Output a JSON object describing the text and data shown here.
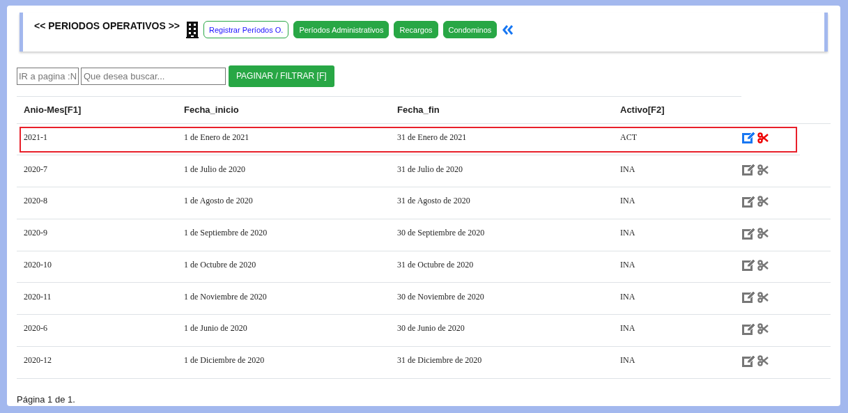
{
  "header": {
    "title": "<< PERIODOS OPERATIVOS >>",
    "buttons": [
      {
        "label": "Registrar Períodos O.",
        "kind": "outline"
      },
      {
        "label": "Períodos Administrativos",
        "kind": "solid"
      },
      {
        "label": "Recargos",
        "kind": "solid"
      },
      {
        "label": "Condominos",
        "kind": "solid"
      }
    ]
  },
  "filter": {
    "page_placeholder": "IR a pagina :N",
    "search_placeholder": "Que desea buscar...",
    "button": "PAGINAR / FILTRAR [F]"
  },
  "table": {
    "columns": [
      "Anio-Mes[F1]",
      "Fecha_inicio",
      "Fecha_fin",
      "Activo[F2]"
    ],
    "rows": [
      {
        "cells": [
          "2021-1",
          "1 de Enero de 2021",
          "31 de Enero de 2021",
          "ACT"
        ],
        "selected": true
      },
      {
        "cells": [
          "2020-7",
          "1 de Julio de 2020",
          "31 de Julio de 2020",
          "INA"
        ],
        "selected": false
      },
      {
        "cells": [
          "2020-8",
          "1 de Agosto de 2020",
          "31 de Agosto de 2020",
          "INA"
        ],
        "selected": false
      },
      {
        "cells": [
          "2020-9",
          "1 de Septiembre de 2020",
          "30 de Septiembre de 2020",
          "INA"
        ],
        "selected": false
      },
      {
        "cells": [
          "2020-10",
          "1 de Octubre de 2020",
          "31 de Octubre de 2020",
          "INA"
        ],
        "selected": false
      },
      {
        "cells": [
          "2020-11",
          "1 de Noviembre de 2020",
          "30 de Noviembre de 2020",
          "INA"
        ],
        "selected": false
      },
      {
        "cells": [
          "2020-6",
          "1 de Junio de 2020",
          "30 de Junio de 2020",
          "INA"
        ],
        "selected": false
      },
      {
        "cells": [
          "2020-12",
          "1 de Diciembre de 2020",
          "31 de Diciembre de 2020",
          "INA"
        ],
        "selected": false
      }
    ]
  },
  "footer": "Página 1 de 1."
}
